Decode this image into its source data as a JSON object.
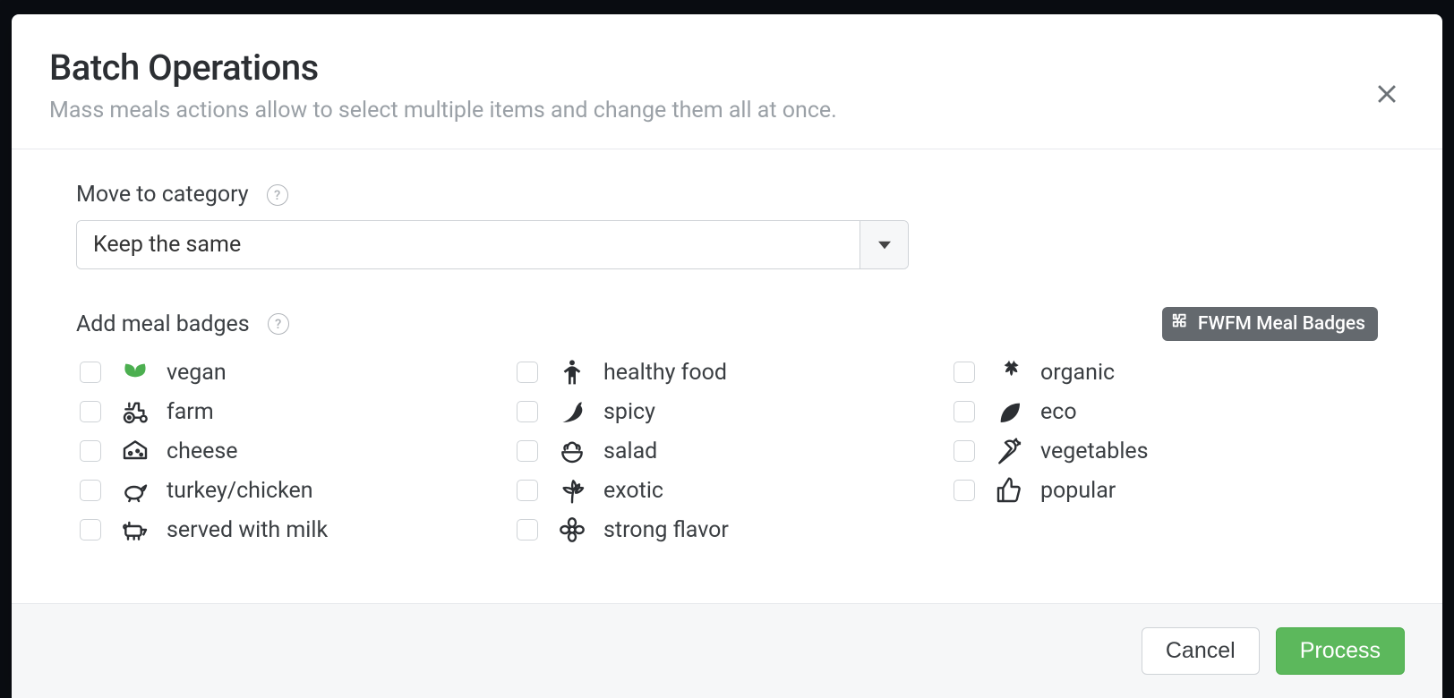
{
  "modal": {
    "title": "Batch Operations",
    "subtitle": "Mass meals actions allow to select multiple items and change them all at once."
  },
  "category": {
    "label": "Move to category",
    "selected": "Keep the same"
  },
  "badges": {
    "label": "Add meal badges",
    "pill_label": "FWFM Meal Badges",
    "items": [
      {
        "key": "vegan",
        "label": "vegan",
        "icon": "seedling-icon",
        "color": "#4caf50"
      },
      {
        "key": "healthy",
        "label": "healthy food",
        "icon": "child-icon",
        "color": "#2c2f33"
      },
      {
        "key": "organic",
        "label": "organic",
        "icon": "herb-icon",
        "color": "#2c2f33"
      },
      {
        "key": "farm",
        "label": "farm",
        "icon": "tractor-icon",
        "color": "#2c2f33"
      },
      {
        "key": "spicy",
        "label": "spicy",
        "icon": "pepper-icon",
        "color": "#2c2f33"
      },
      {
        "key": "eco",
        "label": "eco",
        "icon": "leaf-icon",
        "color": "#2c2f33"
      },
      {
        "key": "cheese",
        "label": "cheese",
        "icon": "cheese-icon",
        "color": "#2c2f33"
      },
      {
        "key": "salad",
        "label": "salad",
        "icon": "salad-icon",
        "color": "#2c2f33"
      },
      {
        "key": "vegetables",
        "label": "vegetables",
        "icon": "carrot-icon",
        "color": "#2c2f33"
      },
      {
        "key": "turkey",
        "label": "turkey/chicken",
        "icon": "turkey-icon",
        "color": "#2c2f33"
      },
      {
        "key": "exotic",
        "label": "exotic",
        "icon": "palm-icon",
        "color": "#2c2f33"
      },
      {
        "key": "popular",
        "label": "popular",
        "icon": "thumbs-up-icon",
        "color": "#2c2f33"
      },
      {
        "key": "milk",
        "label": "served with milk",
        "icon": "cow-icon",
        "color": "#2c2f33"
      },
      {
        "key": "flavor",
        "label": "strong flavor",
        "icon": "flower-icon",
        "color": "#2c2f33"
      }
    ]
  },
  "footer": {
    "cancel": "Cancel",
    "process": "Process"
  }
}
